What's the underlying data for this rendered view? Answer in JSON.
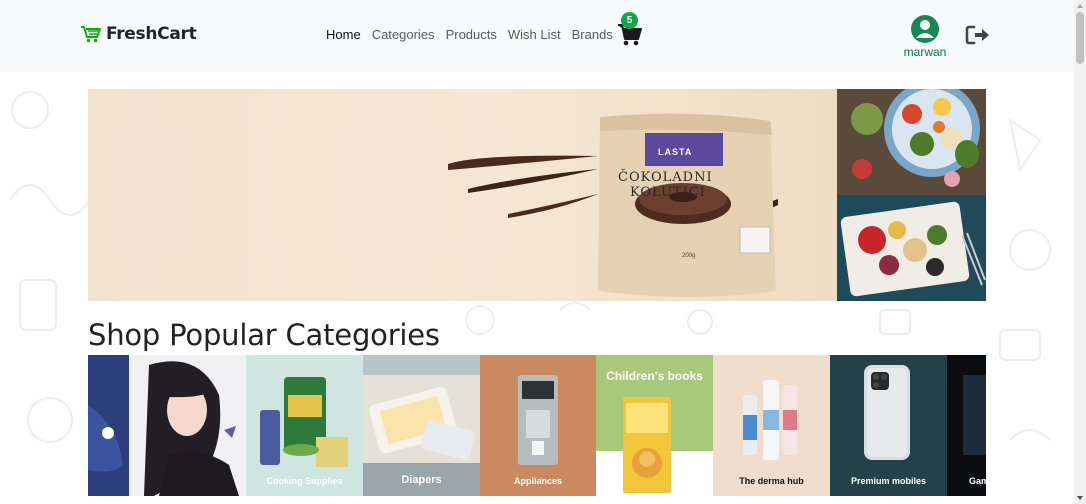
{
  "brand": {
    "name": "FreshCart",
    "icon": "cart-icon",
    "accent": "#0aad0a"
  },
  "nav": {
    "links": [
      {
        "label": "Home",
        "active": true
      },
      {
        "label": "Categories",
        "active": false
      },
      {
        "label": "Products",
        "active": false
      },
      {
        "label": "Wish List",
        "active": false
      },
      {
        "label": "Brands",
        "active": false
      }
    ],
    "cart": {
      "count": "5",
      "icon": "shopping-cart-icon"
    },
    "user": {
      "name": "marwan",
      "icon": "user-circle-icon"
    },
    "logout": {
      "icon": "sign-out-icon"
    }
  },
  "hero": {
    "main_slide": {
      "product_brand": "LASTA",
      "product_name_line1": "ČOKOLADNI",
      "product_name_line2": "KOLUTIĆI",
      "product_weight": "200g"
    }
  },
  "categories_section": {
    "title": "Shop Popular Categories",
    "items": [
      {
        "label": ""
      },
      {
        "label": ""
      },
      {
        "label": "Cooking Supplies"
      },
      {
        "label": "Diapers"
      },
      {
        "label": "Appliances"
      },
      {
        "label": "Children's books",
        "top_label": true
      },
      {
        "label": "The derma hub"
      },
      {
        "label": "Premium mobiles"
      },
      {
        "label": "Gam"
      }
    ]
  },
  "colors": {
    "green": "#16a34a",
    "user_green": "#198754",
    "navbar_bg": "#f8f9fa"
  }
}
